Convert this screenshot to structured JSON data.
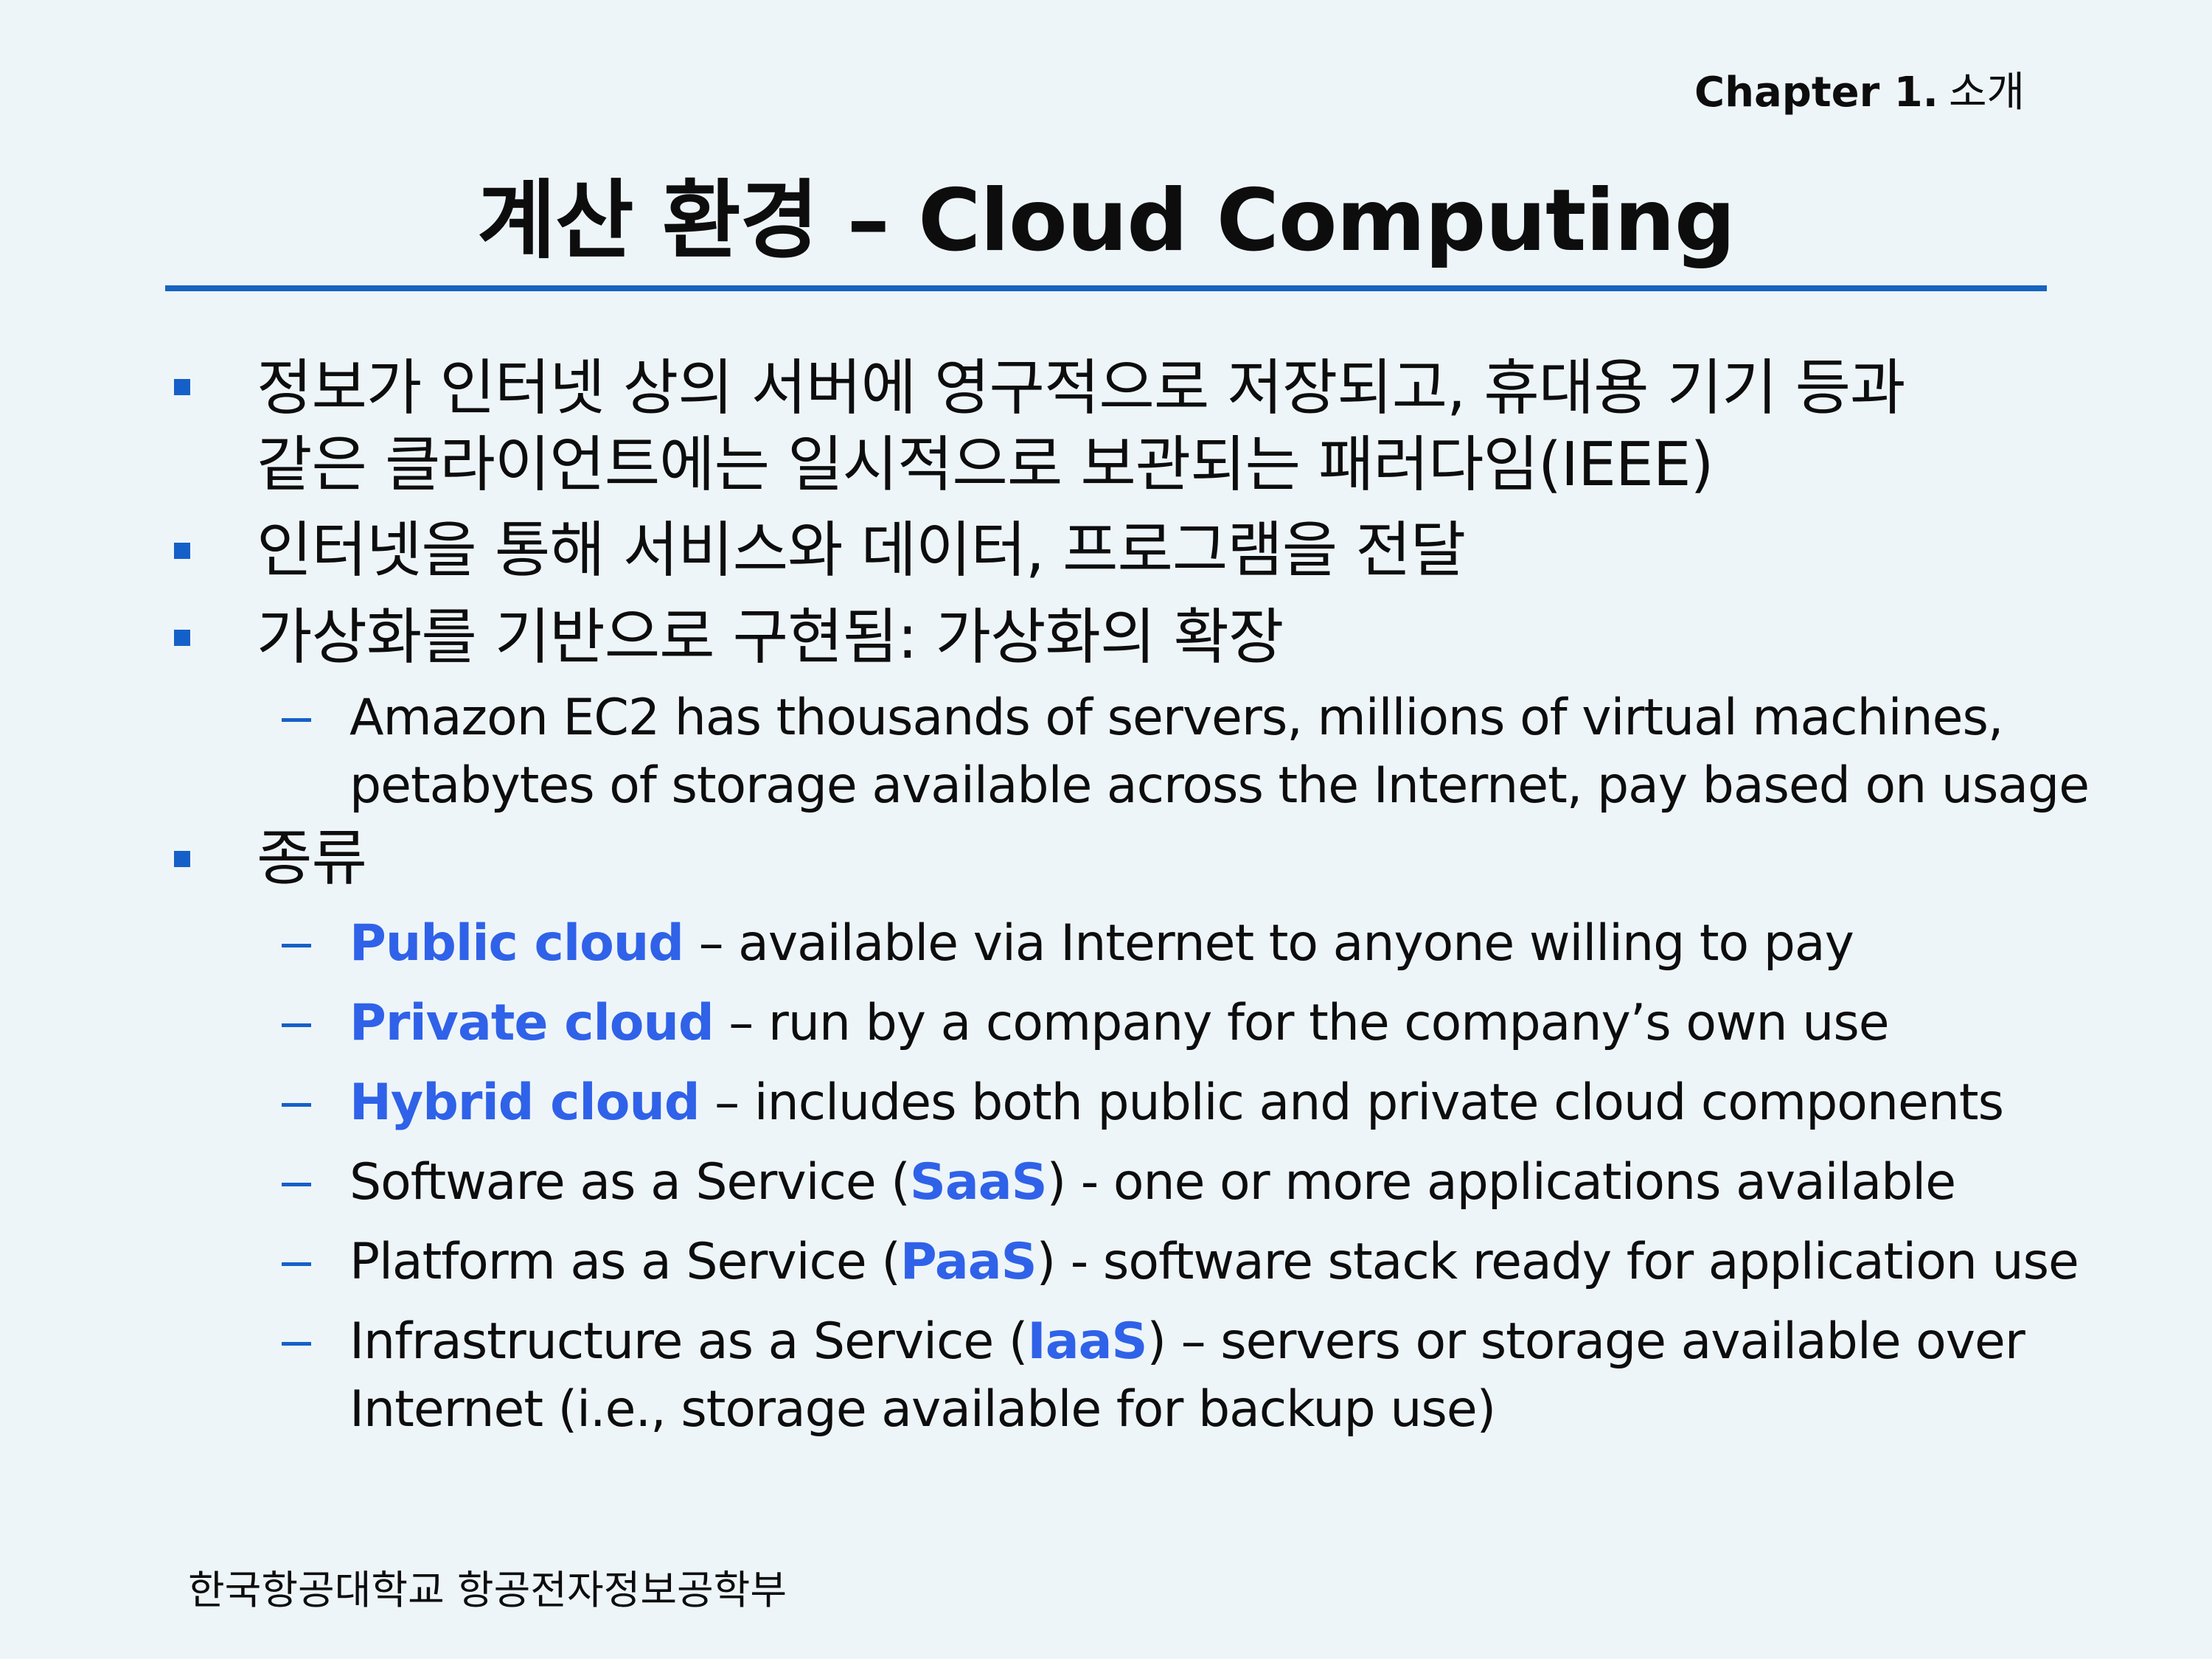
{
  "header": {
    "chapter_number": "Chapter 1.",
    "chapter_name": "소개"
  },
  "title": "계산 환경 – Cloud Computing",
  "bullets": {
    "b1": {
      "line1": "정보가 인터넷 상의 서버에 영구적으로 저장되고, 휴대용 기기 등과",
      "line2": "같은 클라이언트에는 일시적으로 보관되는 패러다임(IEEE)"
    },
    "b2": "인터넷을 통해 서비스와 데이터, 프로그램을 전달",
    "b3": {
      "text": "가상화를 기반으로 구현됨: 가상화의 확장",
      "sub1_line1": "Amazon EC2  has thousands of servers, millions of virtual machines,",
      "sub1_line2": "petabytes of storage available across the Internet, pay based on usage"
    },
    "b4": {
      "text": "종류",
      "public": {
        "term": "Public cloud",
        "rest": " – available via Internet to anyone willing to pay"
      },
      "private": {
        "term": "Private cloud",
        "rest": " – run by a company for the company’s own use"
      },
      "hybrid": {
        "term": "Hybrid cloud",
        "rest": " – includes both public and private cloud components"
      },
      "saas": {
        "pre": "Software as a Service (",
        "term": "SaaS",
        "rest": ") - one or more applications available"
      },
      "paas": {
        "pre": "Platform as a Service (",
        "term": "PaaS",
        "rest": ") - software stack ready for application use"
      },
      "iaas": {
        "pre": "Infrastructure as a Service (",
        "term": "IaaS",
        "rest": ") – servers or storage available over",
        "line2": "Internet (i.e., storage available for backup use)"
      }
    }
  },
  "footer": "한국항공대학교 항공전자정보공학부",
  "colors": {
    "background": "#eef5f9",
    "rule": "#1565c0",
    "bullet": "#1560c8",
    "highlight": "#2f62e8"
  }
}
